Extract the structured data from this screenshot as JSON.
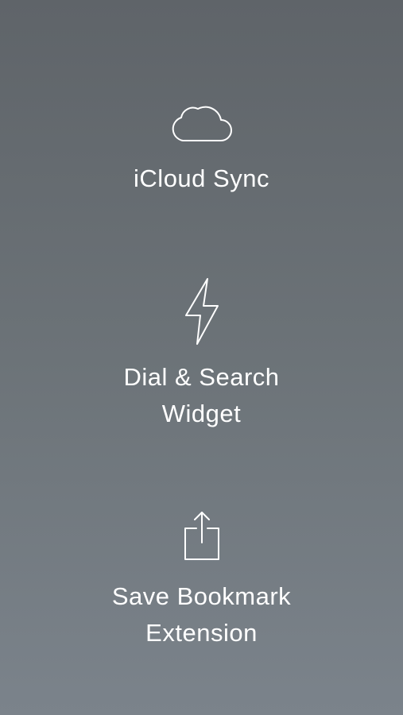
{
  "features": [
    {
      "icon": "cloud-icon",
      "label_lines": [
        "iCloud Sync"
      ]
    },
    {
      "icon": "lightning-bolt-icon",
      "label_lines": [
        "Dial & Search",
        "Widget"
      ]
    },
    {
      "icon": "share-icon",
      "label_lines": [
        "Save Bookmark",
        "Extension"
      ]
    }
  ],
  "colors": {
    "text": "#ffffff",
    "background_top": "#5f6469",
    "background_bottom": "#7b838b"
  }
}
